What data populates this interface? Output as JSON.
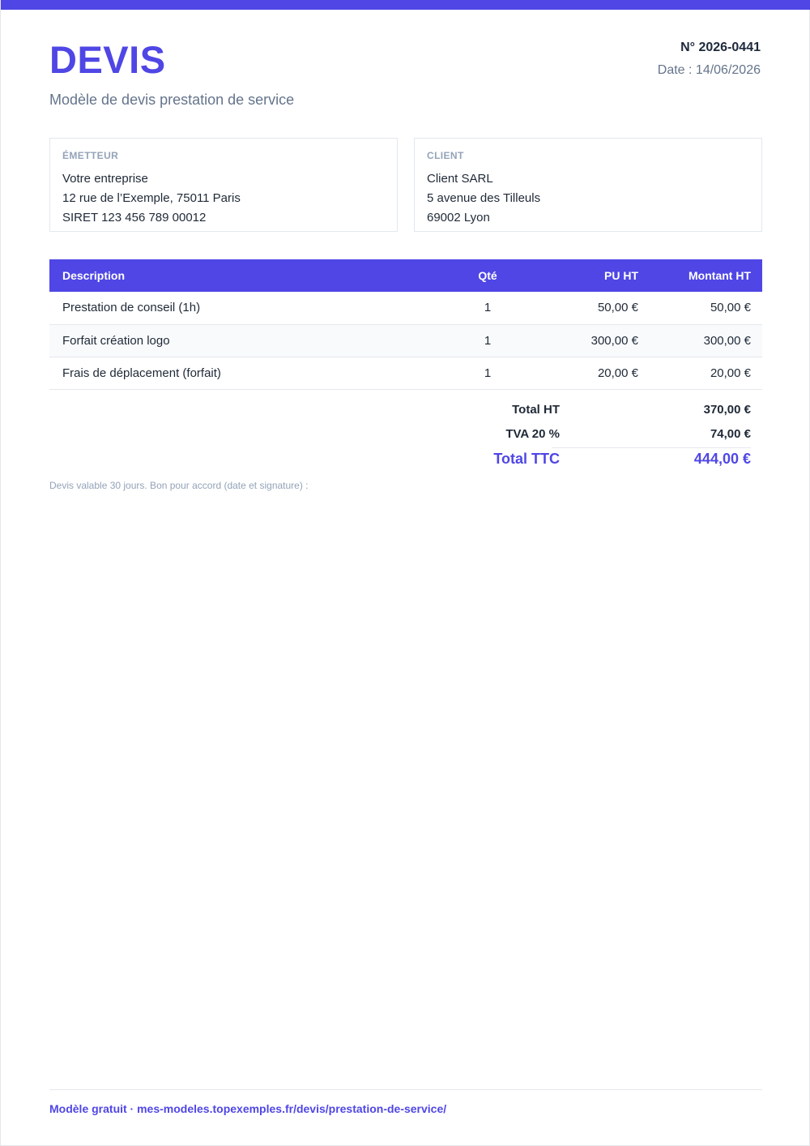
{
  "colors": {
    "accent": "#4f46e5",
    "text": "#1f2937",
    "muted": "#64748b",
    "zebra": "#f8fafc"
  },
  "header": {
    "title": "DEVIS",
    "subtitle": "Modèle de devis prestation de service",
    "number": "N° 2026-0441",
    "date": "Date : 14/06/2026"
  },
  "issuer": {
    "heading": "ÉMETTEUR",
    "lines": [
      "Votre entreprise",
      "12 rue de l’Exemple, 75011 Paris",
      "SIRET 123 456 789 00012"
    ]
  },
  "client": {
    "heading": "CLIENT",
    "lines": [
      "Client SARL",
      "5 avenue des Tilleuls",
      "69002 Lyon"
    ]
  },
  "table": {
    "headers": {
      "description": "Description",
      "qty": "Qté",
      "unit_price": "PU HT",
      "amount": "Montant HT"
    },
    "rows": [
      {
        "description": "Prestation de conseil (1h)",
        "qty": "1",
        "unit_price": "50,00 €",
        "amount": "50,00 €"
      },
      {
        "description": "Forfait création logo",
        "qty": "1",
        "unit_price": "300,00 €",
        "amount": "300,00 €"
      },
      {
        "description": "Frais de déplacement (forfait)",
        "qty": "1",
        "unit_price": "20,00 €",
        "amount": "20,00 €"
      }
    ]
  },
  "totals": {
    "subtotal_label": "Total HT",
    "subtotal_value": "370,00 €",
    "vat_label": "TVA 20 %",
    "vat_value": "74,00 €",
    "grand_label": "Total TTC",
    "grand_value": "444,00 €"
  },
  "note": "Devis valable 30 jours. Bon pour accord (date et signature) :",
  "footer": {
    "link_text": "Modèle gratuit · mes-modeles.topexemples.fr/devis/prestation-de-service/"
  }
}
